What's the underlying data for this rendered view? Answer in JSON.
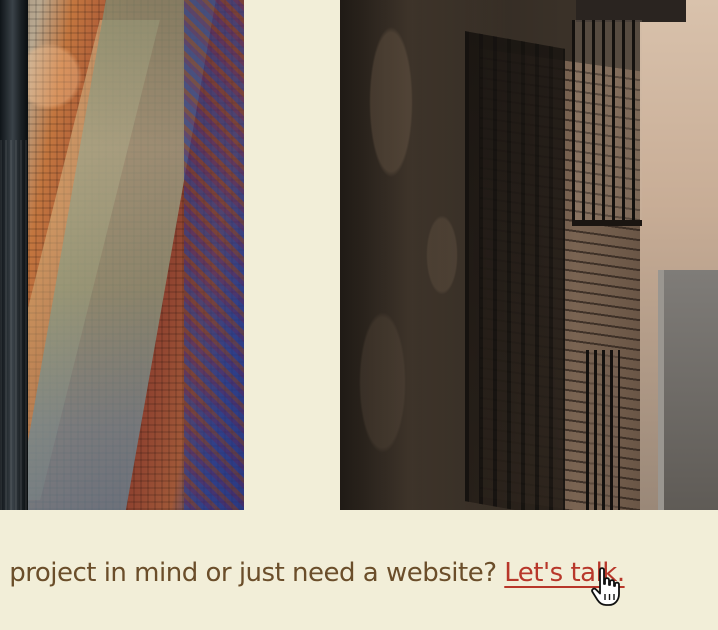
{
  "gallery": {
    "left_image_alt": "",
    "right_image_alt": ""
  },
  "cta": {
    "lead_text": "a project in mind or just need a website?",
    "link_text": "Let's talk."
  },
  "icons": {
    "cursor": "hand-pointer-icon"
  },
  "colors": {
    "background": "#f2eed8",
    "text": "#6b4e2a",
    "link": "#b8372a"
  }
}
